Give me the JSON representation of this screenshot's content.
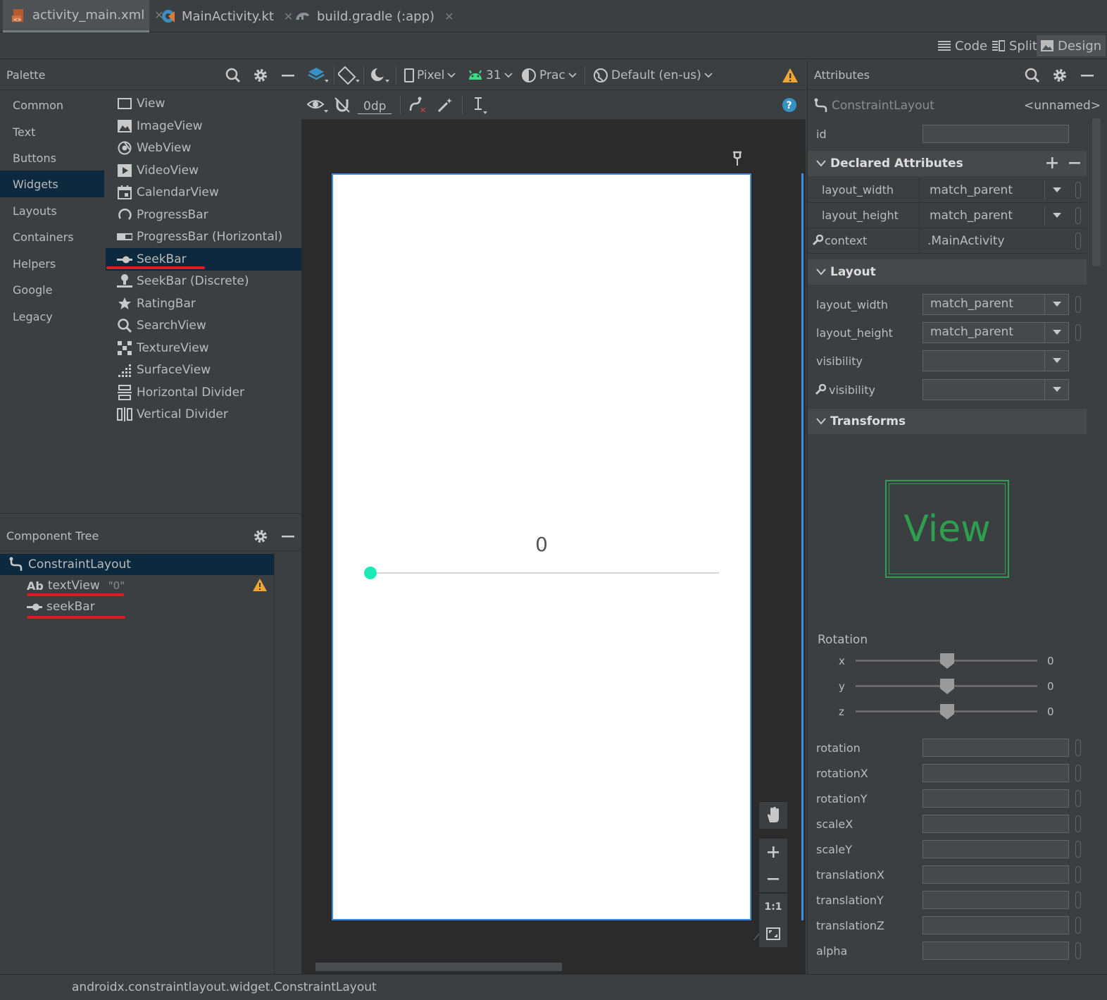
{
  "tabs": [
    {
      "label": "activity_main.xml",
      "icon": "layout-file-icon",
      "active": true
    },
    {
      "label": "MainActivity.kt",
      "icon": "kotlin-file-icon",
      "active": false
    },
    {
      "label": "build.gradle (:app)",
      "icon": "gradle-file-icon",
      "active": false
    }
  ],
  "view_modes": {
    "code": "Code",
    "split": "Split",
    "design": "Design"
  },
  "palette": {
    "title": "Palette",
    "categories": [
      "Common",
      "Text",
      "Buttons",
      "Widgets",
      "Layouts",
      "Containers",
      "Helpers",
      "Google",
      "Legacy"
    ],
    "selected_category": "Widgets",
    "widgets": [
      "View",
      "ImageView",
      "WebView",
      "VideoView",
      "CalendarView",
      "ProgressBar",
      "ProgressBar (Horizontal)",
      "SeekBar",
      "SeekBar (Discrete)",
      "RatingBar",
      "SearchView",
      "TextureView",
      "SurfaceView",
      "Horizontal Divider",
      "Vertical Divider"
    ],
    "selected_widget": "SeekBar"
  },
  "component_tree": {
    "title": "Component Tree",
    "root": "ConstraintLayout",
    "children": [
      {
        "icon_text": "Ab",
        "name": "textView",
        "hint": "\"0\"",
        "warning": true
      },
      {
        "icon_text": "",
        "name": "seekBar",
        "hint": "",
        "warning": false
      }
    ]
  },
  "toolbar": {
    "device": "Pixel",
    "api": "31",
    "theme": "Prac",
    "locale": "Default (en-us)",
    "margin": "0dp"
  },
  "preview": {
    "text_value": "0",
    "seekbar_progress": 0.0,
    "accent_color": "#1de9b6"
  },
  "attributes": {
    "title": "Attributes",
    "component": "ConstraintLayout",
    "component_id_display": "<unnamed>",
    "id_label": "id",
    "declared_title": "Declared Attributes",
    "declared": [
      {
        "name": "layout_width",
        "value": "match_parent",
        "dropdown": true
      },
      {
        "name": "layout_height",
        "value": "match_parent",
        "dropdown": true
      },
      {
        "name": "context",
        "value": ".MainActivity",
        "dropdown": false
      }
    ],
    "layout_title": "Layout",
    "layout": [
      {
        "name": "layout_width",
        "value": "match_parent"
      },
      {
        "name": "layout_height",
        "value": "match_parent"
      },
      {
        "name": "visibility",
        "value": ""
      },
      {
        "name": "visibility",
        "value": ""
      }
    ],
    "transforms_title": "Transforms",
    "transform_preview": "View",
    "rotation_label": "Rotation",
    "rotation_axes": [
      {
        "axis": "x",
        "value": "0"
      },
      {
        "axis": "y",
        "value": "0"
      },
      {
        "axis": "z",
        "value": "0"
      }
    ],
    "transform_fields": [
      "rotation",
      "rotationX",
      "rotationY",
      "scaleX",
      "scaleY",
      "translationX",
      "translationY",
      "translationZ",
      "alpha"
    ]
  },
  "status": {
    "text": "androidx.constraintlayout.widget.ConstraintLayout"
  },
  "colors": {
    "selection": "#0d293e",
    "annotation_red": "#e01b24",
    "warning": "#f0a732",
    "help": "#3592c4"
  }
}
